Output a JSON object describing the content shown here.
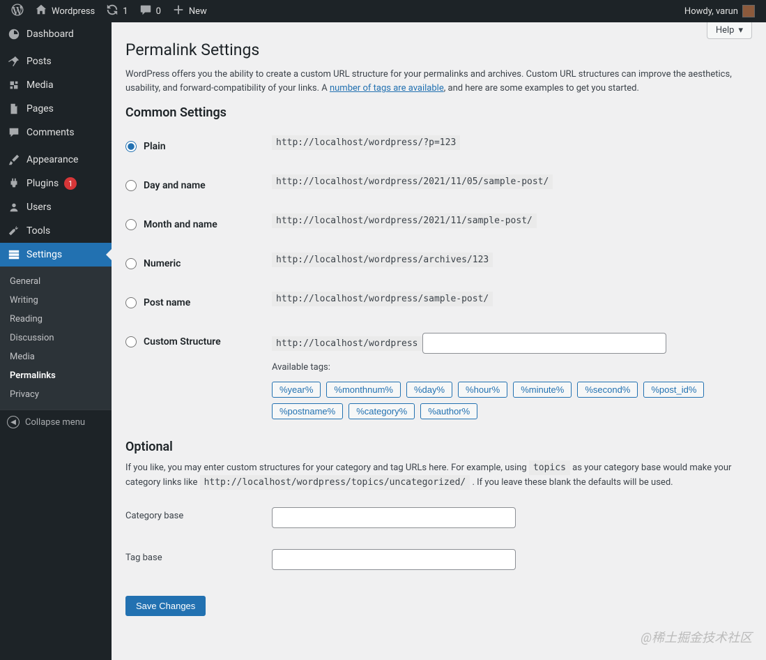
{
  "adminbar": {
    "site_name": "Wordpress",
    "updates_count": "1",
    "comments_count": "0",
    "new_label": "New",
    "howdy": "Howdy, varun"
  },
  "sidebar": {
    "items": [
      {
        "label": "Dashboard"
      },
      {
        "label": "Posts"
      },
      {
        "label": "Media"
      },
      {
        "label": "Pages"
      },
      {
        "label": "Comments"
      },
      {
        "label": "Appearance"
      },
      {
        "label": "Plugins",
        "badge": "1"
      },
      {
        "label": "Users"
      },
      {
        "label": "Tools"
      },
      {
        "label": "Settings"
      }
    ],
    "submenu": [
      {
        "label": "General"
      },
      {
        "label": "Writing"
      },
      {
        "label": "Reading"
      },
      {
        "label": "Discussion"
      },
      {
        "label": "Media"
      },
      {
        "label": "Permalinks"
      },
      {
        "label": "Privacy"
      }
    ],
    "collapse_label": "Collapse menu"
  },
  "page": {
    "help_label": "Help",
    "title": "Permalink Settings",
    "intro_a": "WordPress offers you the ability to create a custom URL structure for your permalinks and archives. Custom URL structures can improve the aesthetics, usability, and forward-compatibility of your links. A ",
    "intro_link": "number of tags are available",
    "intro_b": ", and here are some examples to get you started.",
    "common_heading": "Common Settings",
    "options": [
      {
        "label": "Plain",
        "example": "http://localhost/wordpress/?p=123"
      },
      {
        "label": "Day and name",
        "example": "http://localhost/wordpress/2021/11/05/sample-post/"
      },
      {
        "label": "Month and name",
        "example": "http://localhost/wordpress/2021/11/sample-post/"
      },
      {
        "label": "Numeric",
        "example": "http://localhost/wordpress/archives/123"
      },
      {
        "label": "Post name",
        "example": "http://localhost/wordpress/sample-post/"
      }
    ],
    "custom_label": "Custom Structure",
    "custom_prefix": "http://localhost/wordpress",
    "custom_value": "",
    "available_tags_label": "Available tags:",
    "tags": [
      "%year%",
      "%monthnum%",
      "%day%",
      "%hour%",
      "%minute%",
      "%second%",
      "%post_id%",
      "%postname%",
      "%category%",
      "%author%"
    ],
    "optional_heading": "Optional",
    "optional_a": "If you like, you may enter custom structures for your category and tag URLs here. For example, using ",
    "optional_code1": "topics",
    "optional_b": " as your category base would make your category links like ",
    "optional_code2": "http://localhost/wordpress/topics/uncategorized/",
    "optional_c": " . If you leave these blank the defaults will be used.",
    "category_base_label": "Category base",
    "category_base_value": "",
    "tag_base_label": "Tag base",
    "tag_base_value": "",
    "submit_label": "Save Changes"
  },
  "watermark": "@稀土掘金技术社区"
}
